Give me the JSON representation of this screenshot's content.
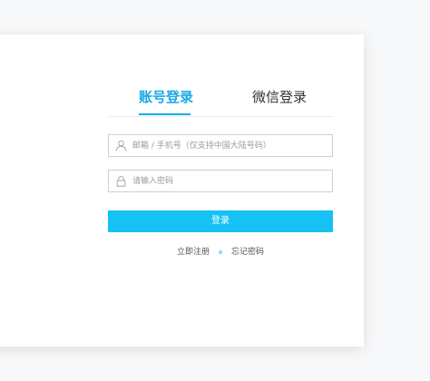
{
  "tabs": {
    "account_login": "账号登录",
    "wechat_login": "微信登录"
  },
  "form": {
    "email_placeholder": "邮箱 / 手机号（仅支持中国大陆号码）",
    "password_placeholder": "请输入密码",
    "login_button": "登录"
  },
  "links": {
    "register": "立即注册",
    "forgot_password": "忘记密码"
  },
  "icons": {
    "user": "user-icon",
    "lock": "lock-icon",
    "separator": "dot-separator"
  },
  "colors": {
    "accent": "#17a9e6",
    "button": "#15c1f5",
    "separator_dot": "#8fd5f3"
  }
}
